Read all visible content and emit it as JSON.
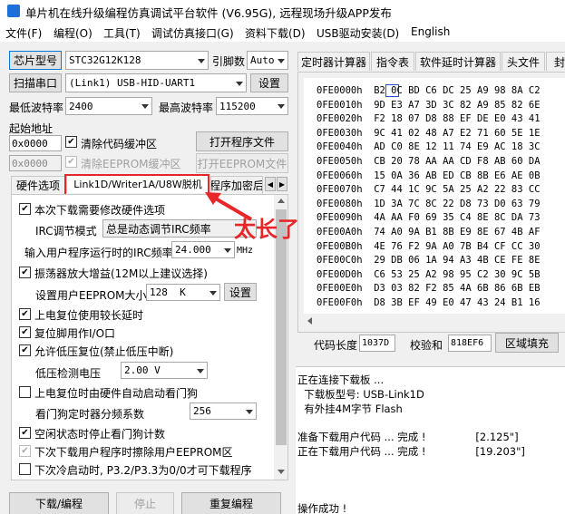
{
  "window": {
    "title": "单片机在线升级编程仿真调试平台软件 (V6.95G), 远程现场升级APP发布"
  },
  "menu": [
    "文件(F)",
    "编程(O)",
    "工具(T)",
    "调试仿真接口(G)",
    "资料下载(D)",
    "USB驱动安装(D)",
    "English"
  ],
  "chip": {
    "button": "芯片型号",
    "model": "STC32G12K128",
    "pin_label": "引脚数",
    "pin_value": "Auto"
  },
  "port": {
    "button": "扫描串口",
    "value": "(Link1) USB-HID-UART1",
    "settings": "设置"
  },
  "baud": {
    "min_label": "最低波特率",
    "min_value": "2400",
    "max_label": "最高波特率",
    "max_value": "115200"
  },
  "start_addr": {
    "label": "起始地址",
    "code_addr": "0x0000",
    "eeprom_addr": "0x0000",
    "clear_code": "清除代码缓冲区",
    "clear_eeprom": "清除EEPROM缓冲区",
    "open_program": "打开程序文件",
    "open_eeprom": "打开EEPROM文件"
  },
  "left_tabs": [
    "硬件选项",
    "Link1D/Writer1A/U8W脱机",
    "程序加密后"
  ],
  "options": {
    "opt1": "本次下载需要修改硬件选项",
    "irc_mode_label": "IRC调节模式",
    "irc_mode_value": "总是动态调节IRC频率",
    "irc_freq_label": "输入用户程序运行时的IRC频率",
    "irc_freq_value": "24.000",
    "irc_unit": "MHz",
    "opt_amp": "振荡器放大增益(12M以上建议选择)",
    "eeprom_size_label": "设置用户EEPROM大小",
    "eeprom_size_value": "128  K",
    "eeprom_set": "设置",
    "opt_delay": "上电复位使用较长延时",
    "opt_reset_io": "复位脚用作I/O口",
    "opt_lvd": "允许低压复位(禁止低压中断)",
    "lvd_label": "低压检测电压",
    "lvd_value": "2.00 V",
    "opt_wdt": "上电复位时由硬件自动启动看门狗",
    "wdt_div_label": "看门狗定时器分频系数",
    "wdt_div_value": "256",
    "opt_idle_wdt": "空闲状态时停止看门狗计数",
    "opt_eeprom_erase": "下次下载用户程序时擦除用户EEPROM区",
    "opt_cold_boot": "下次冷启动时, P3.2/P3.3为0/0才可下载程序"
  },
  "bottom_buttons": {
    "download": "下载/编程",
    "stop": "停止",
    "redownload": "重复编程"
  },
  "annotation": {
    "text": "太长了"
  },
  "right_tabs": [
    "定时器计算器",
    "指令表",
    "软件延时计算器",
    "头文件",
    "封"
  ],
  "hex": [
    {
      "addr": "0FE0000h",
      "bytes": "B2 0C BD C6 DC 25 A9 98 8A C2"
    },
    {
      "addr": "0FE0010h",
      "bytes": "9D E3 A7 3D 3C 82 A9 85 82 6E"
    },
    {
      "addr": "0FE0020h",
      "bytes": "F2 18 07 D8 88 EF DE E0 43 41"
    },
    {
      "addr": "0FE0030h",
      "bytes": "9C 41 02 48 A7 E2 71 60 5E 1E"
    },
    {
      "addr": "0FE0040h",
      "bytes": "AD C0 8E 12 11 74 E9 AC 18 3C"
    },
    {
      "addr": "0FE0050h",
      "bytes": "CB 20 78 AA AA CD F8 AB 60 DA"
    },
    {
      "addr": "0FE0060h",
      "bytes": "15 0A 36 AB ED CB 8B E6 AE 0B"
    },
    {
      "addr": "0FE0070h",
      "bytes": "C7 44 1C 9C 5A 25 A2 22 83 CC"
    },
    {
      "addr": "0FE0080h",
      "bytes": "1D 3A 7C 8C 22 D8 73 D0 63 79"
    },
    {
      "addr": "0FE0090h",
      "bytes": "4A AA F0 69 35 C4 8E 8C DA 73"
    },
    {
      "addr": "0FE00A0h",
      "bytes": "74 A0 9A B1 8B E9 8E 67 4B AF"
    },
    {
      "addr": "0FE00B0h",
      "bytes": "4E 76 F2 9A A0 7B B4 CF CC 30"
    },
    {
      "addr": "0FE00C0h",
      "bytes": "29 DB 06 1A 94 A3 4B CE FE 8E"
    },
    {
      "addr": "0FE00D0h",
      "bytes": "C6 53 25 A2 98 95 C2 30 9C 5B"
    },
    {
      "addr": "0FE00E0h",
      "bytes": "D3 03 82 F2 85 4A 6B 86 6B EB"
    },
    {
      "addr": "0FE00F0h",
      "bytes": "D8 3B EF 49 E0 47 43 24 B1 16"
    }
  ],
  "code_len": {
    "label": "代码长度",
    "value": "1037D",
    "checksum_label": "校验和",
    "checksum_value": "818EF6",
    "fill_button": "区域填充"
  },
  "log": [
    "正在连接下载板 ...",
    "  下载板型号: USB-Link1D",
    "  有外挂4M字节 Flash",
    "",
    "准备下载用户代码 ... 完成 !               [2.125\"]",
    "正在下载用户代码 ... 完成 !               [19.203\"]",
    "",
    "",
    "",
    "操作成功 !"
  ]
}
